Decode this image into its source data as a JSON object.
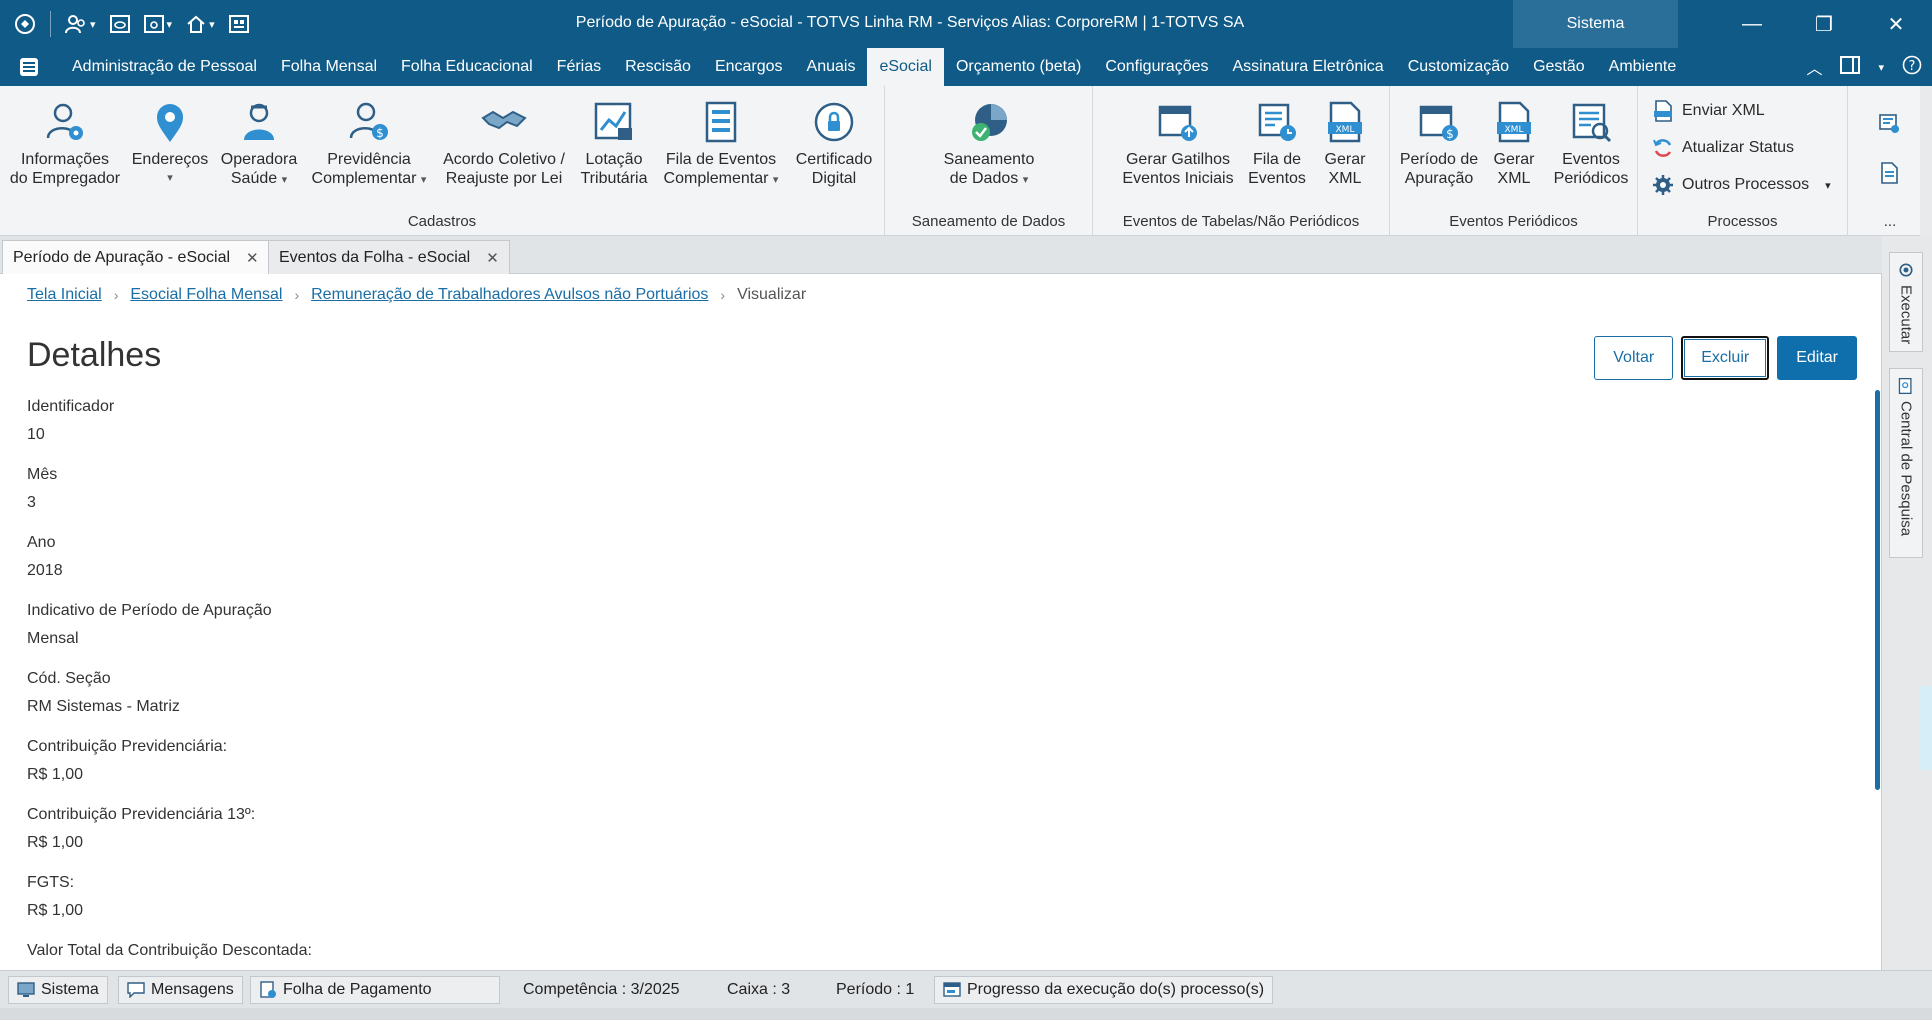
{
  "window": {
    "title": "Período de Apuração - eSocial - TOTVS Linha RM - Serviços  Alias: CorporeRM | 1-TOTVS SA",
    "sistema_label": "Sistema",
    "minimize": "—",
    "restore": "❐",
    "close": "✕"
  },
  "menu": {
    "items": [
      "Administração de Pessoal",
      "Folha Mensal",
      "Folha Educacional",
      "Férias",
      "Rescisão",
      "Encargos",
      "Anuais",
      "eSocial",
      "Orçamento (beta)",
      "Configurações",
      "Assinatura Eletrônica",
      "Customização",
      "Gestão",
      "Ambiente"
    ],
    "active": "eSocial"
  },
  "ribbon": {
    "cadastros": {
      "label": "Cadastros",
      "buttons": [
        {
          "line1": "Informações",
          "line2": "do Empregador",
          "icon": "user-gear-icon"
        },
        {
          "line1": "Endereços",
          "line2": "",
          "icon": "map-pin-icon"
        },
        {
          "line1": "Operadora",
          "line2": "Saúde",
          "icon": "doctor-icon"
        },
        {
          "line1": "Previdência",
          "line2": "Complementar",
          "icon": "user-money-icon"
        },
        {
          "line1": "Acordo Coletivo /",
          "line2": "Reajuste por Lei",
          "icon": "handshake-icon"
        },
        {
          "line1": "Lotação",
          "line2": "Tributária",
          "icon": "chart-icon"
        },
        {
          "line1": "Fila de Eventos",
          "line2": "Complementar",
          "icon": "queue-icon"
        },
        {
          "line1": "Certificado",
          "line2": "Digital",
          "icon": "certificate-lock-icon"
        }
      ]
    },
    "saneamento": {
      "label": "Saneamento de Dados",
      "button": {
        "line1": "Saneamento",
        "line2": "de Dados",
        "icon": "pie-check-icon"
      }
    },
    "eventos_tabelas": {
      "label": "Eventos de Tabelas/Não Periódicos",
      "buttons": [
        {
          "line1": "Gerar Gatilhos",
          "line2": "Eventos Iniciais",
          "icon": "calendar-upload-icon"
        },
        {
          "line1": "Fila de",
          "line2": "Eventos",
          "icon": "event-queue-icon"
        },
        {
          "line1": "Gerar",
          "line2": "XML",
          "icon": "xml-file-icon"
        }
      ]
    },
    "eventos_periodicos": {
      "label": "Eventos Periódicos",
      "buttons": [
        {
          "line1": "Período de",
          "line2": "Apuração",
          "icon": "calendar-money-icon"
        },
        {
          "line1": "Gerar",
          "line2": "XML",
          "icon": "xml-file-icon"
        },
        {
          "line1": "Eventos",
          "line2": "Periódicos",
          "icon": "periodic-events-icon"
        }
      ]
    },
    "processos": {
      "label": "Processos",
      "items": [
        {
          "label": "Enviar XML",
          "icon": "send-xml-icon"
        },
        {
          "label": "Atualizar Status",
          "icon": "refresh-icon"
        },
        {
          "label": "Outros Processos",
          "icon": "gear-icon"
        }
      ]
    },
    "more": "..."
  },
  "tabs": [
    {
      "label": "Período de Apuração - eSocial",
      "active": true
    },
    {
      "label": "Eventos da Folha - eSocial",
      "active": false
    }
  ],
  "breadcrumb": {
    "items": [
      "Tela Inicial",
      "Esocial Folha Mensal",
      "Remuneração de Trabalhadores Avulsos não Portuários"
    ],
    "current": "Visualizar"
  },
  "page": {
    "title": "Detalhes",
    "actions": {
      "back": "Voltar",
      "delete": "Excluir",
      "edit": "Editar"
    }
  },
  "fields": [
    {
      "label": "Identificador",
      "value": "10"
    },
    {
      "label": "Mês",
      "value": "3"
    },
    {
      "label": "Ano",
      "value": "2018"
    },
    {
      "label": "Indicativo de Período de Apuração",
      "value": "Mensal"
    },
    {
      "label": "Cód. Seção",
      "value": "RM Sistemas - Matriz"
    },
    {
      "label": "Contribuição Previdenciária:",
      "value": "R$ 1,00"
    },
    {
      "label": "Contribuição Previdenciária 13º:",
      "value": "R$ 1,00"
    },
    {
      "label": "FGTS:",
      "value": "R$ 1,00"
    },
    {
      "label": "Valor Total da Contribuição Descontada:",
      "value": ""
    }
  ],
  "sidepanel": {
    "executar": "Executar",
    "central": "Central de Pesquisa"
  },
  "statusbar": {
    "sistema": "Sistema",
    "mensagens": "Mensagens",
    "folha": "Folha de Pagamento",
    "competencia": "Competência : 3/2025",
    "caixa": "Caixa : 3",
    "periodo": "Período : 1",
    "progresso": "Progresso da execução do(s) processo(s)"
  },
  "colors": {
    "brand": "#0f5a86",
    "link": "#1a6ea5",
    "primary_button": "#0f6fad"
  }
}
